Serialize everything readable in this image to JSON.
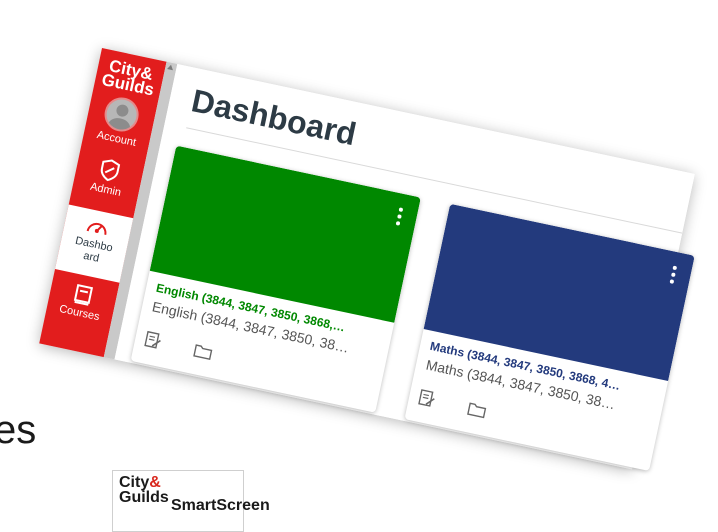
{
  "background": {
    "partial_text": "es",
    "logo": {
      "brand": "City & Guilds",
      "product": "SmartScreen"
    }
  },
  "nav": {
    "logo": "City & Guilds",
    "items": [
      {
        "label": "Account",
        "icon": "user-avatar-icon",
        "active": false
      },
      {
        "label": "Admin",
        "icon": "shield-icon",
        "active": false
      },
      {
        "label": "Dashboard",
        "icon": "dashboard-gauge-icon",
        "active": true
      },
      {
        "label": "Courses",
        "icon": "courses-book-icon",
        "active": false
      }
    ],
    "colors": {
      "nav_bg": "#e21d1d",
      "active_bg": "#ffffff"
    }
  },
  "page": {
    "title": "Dashboard"
  },
  "cards": [
    {
      "title": "English (3844, 3847, 3850, 3868,…",
      "subtitle": "English (3844, 3847, 3850, 38…",
      "color": "#008800",
      "title_color": "#008800",
      "icons": [
        "assignments-icon",
        "folder-icon"
      ]
    },
    {
      "title": "Maths (3844, 3847, 3850, 3868, 4…",
      "subtitle": "Maths (3844, 3847, 3850, 38…",
      "color": "#233a7d",
      "title_color": "#233a7d",
      "icons": [
        "assignments-icon",
        "folder-icon"
      ]
    }
  ]
}
